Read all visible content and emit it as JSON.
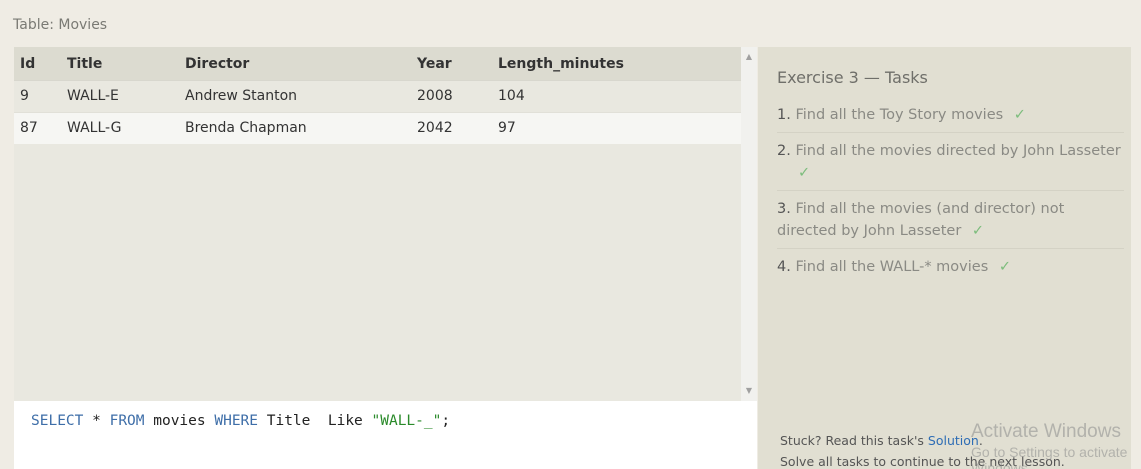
{
  "table": {
    "caption": "Table: Movies",
    "columns": [
      "Id",
      "Title",
      "Director",
      "Year",
      "Length_minutes"
    ],
    "rows": [
      [
        "9",
        "WALL-E",
        "Andrew Stanton",
        "2008",
        "104"
      ],
      [
        "87",
        "WALL-G",
        "Brenda Chapman",
        "2042",
        "97"
      ]
    ]
  },
  "editor": {
    "tokens": [
      {
        "text": "SELECT",
        "type": "kw"
      },
      {
        "text": " * ",
        "type": "plain"
      },
      {
        "text": "FROM",
        "type": "kw"
      },
      {
        "text": " movies ",
        "type": "plain"
      },
      {
        "text": "WHERE",
        "type": "kw"
      },
      {
        "text": " Title  Like ",
        "type": "plain"
      },
      {
        "text": "\"WALL-_\"",
        "type": "str"
      },
      {
        "text": ";",
        "type": "plain"
      }
    ]
  },
  "tasks": {
    "title": "Exercise 3 — Tasks",
    "check_glyph": "✓",
    "items": [
      {
        "num": "1.",
        "label": "Find all the Toy Story movies",
        "done": true
      },
      {
        "num": "2.",
        "label": "Find all the movies directed by John Lasseter",
        "done": true
      },
      {
        "num": "3.",
        "label": "Find all the movies (and director) not directed by John Lasseter",
        "done": true
      },
      {
        "num": "4.",
        "label": "Find all the WALL-* movies",
        "done": true
      }
    ]
  },
  "footer": {
    "stuck_prefix": "Stuck? Read this task's ",
    "solution_link": "Solution",
    "stuck_suffix": ".",
    "solve_text": "Solve all tasks to continue to the next lesson."
  },
  "watermark": {
    "title": "Activate Windows",
    "subtitle": "Go to Settings to activate Windows."
  },
  "scrollbar": {
    "up_glyph": "▲",
    "down_glyph": "▼"
  },
  "colors": {
    "keyword": "#3e6ea8",
    "string": "#2a8a2a",
    "check": "#7dbd7d",
    "link": "#2e6db5"
  }
}
